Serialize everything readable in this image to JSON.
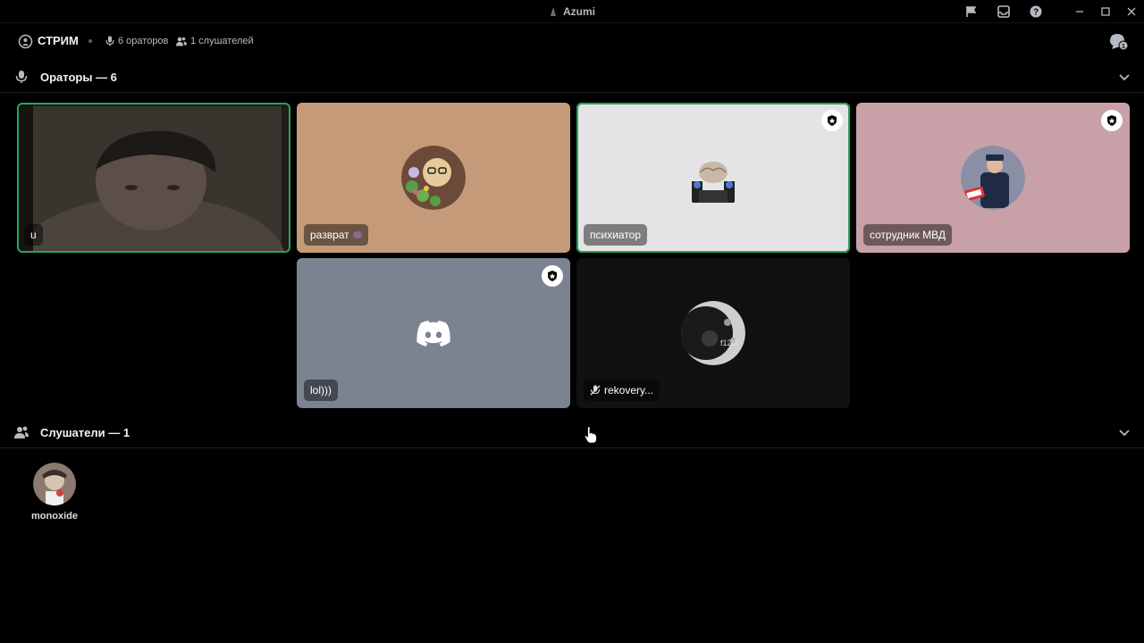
{
  "window": {
    "title": "Azumi"
  },
  "header": {
    "title": "СТРИМ",
    "speakers_count": "6 ораторов",
    "listeners_count": "1 слушателей",
    "inbox_badge": "1"
  },
  "speakers_section": {
    "label": "Ораторы — 6"
  },
  "listeners_section": {
    "label": "Слушатели — 1"
  },
  "tiles": [
    {
      "name": "u",
      "background": "#2a2622",
      "speaking": true,
      "moderator": false,
      "video": true
    },
    {
      "name": "разврат",
      "background": "#c49a78",
      "speaking": false,
      "moderator": false
    },
    {
      "name": "психиатор",
      "background": "#e4e4e6",
      "speaking": true,
      "moderator": true
    },
    {
      "name": "сотрудник МВД",
      "background": "#c8a1a8",
      "speaking": false,
      "moderator": true
    },
    {
      "name": "lol)))",
      "background": "#7b8290",
      "speaking": false,
      "moderator": true,
      "default_avatar": true
    },
    {
      "name": "rekovery...",
      "background": "#111111",
      "speaking": false,
      "moderator": false,
      "muted": true
    }
  ],
  "listeners": [
    {
      "name": "monoxide"
    }
  ],
  "colors": {
    "speaking_ring": "#23a559",
    "background": "#000000"
  }
}
